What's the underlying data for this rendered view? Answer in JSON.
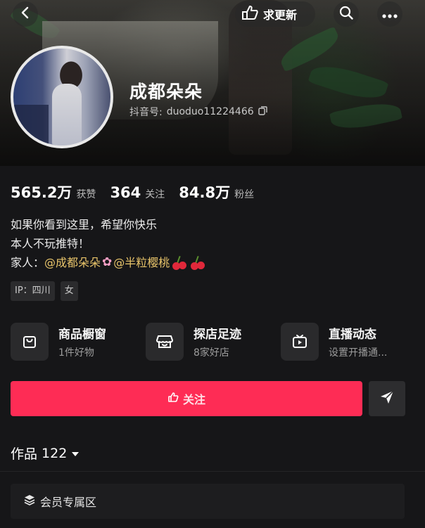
{
  "header": {
    "update_label": "求更新"
  },
  "profile": {
    "name": "成都朵朵",
    "id_label": "抖音号:",
    "id_value": "duoduo11224466"
  },
  "stats": [
    {
      "value": "565.2万",
      "label": "获赞"
    },
    {
      "value": "364",
      "label": "关注"
    },
    {
      "value": "84.8万",
      "label": "粉丝"
    }
  ],
  "bio": {
    "line1": "如果你看到这里，希望你快乐",
    "line2": "本人不玩推特！",
    "family_label": "家人：",
    "mention1": "@成都朵朵",
    "mention2": "@半粒樱桃"
  },
  "tags": [
    "IP：四川",
    "女"
  ],
  "features": [
    {
      "title": "商品橱窗",
      "sub": "1件好物",
      "icon": "shopping-bag-icon"
    },
    {
      "title": "探店足迹",
      "sub": "8家好店",
      "icon": "store-icon"
    },
    {
      "title": "直播动态",
      "sub": "设置开播通...",
      "icon": "tv-icon"
    }
  ],
  "follow": {
    "label": "关注"
  },
  "works": {
    "label": "作品",
    "count": "122"
  },
  "member": {
    "label": "会员专属区"
  },
  "colors": {
    "follow_button": "#fe2c55",
    "mention": "#e8c46a",
    "background": "#161618"
  }
}
